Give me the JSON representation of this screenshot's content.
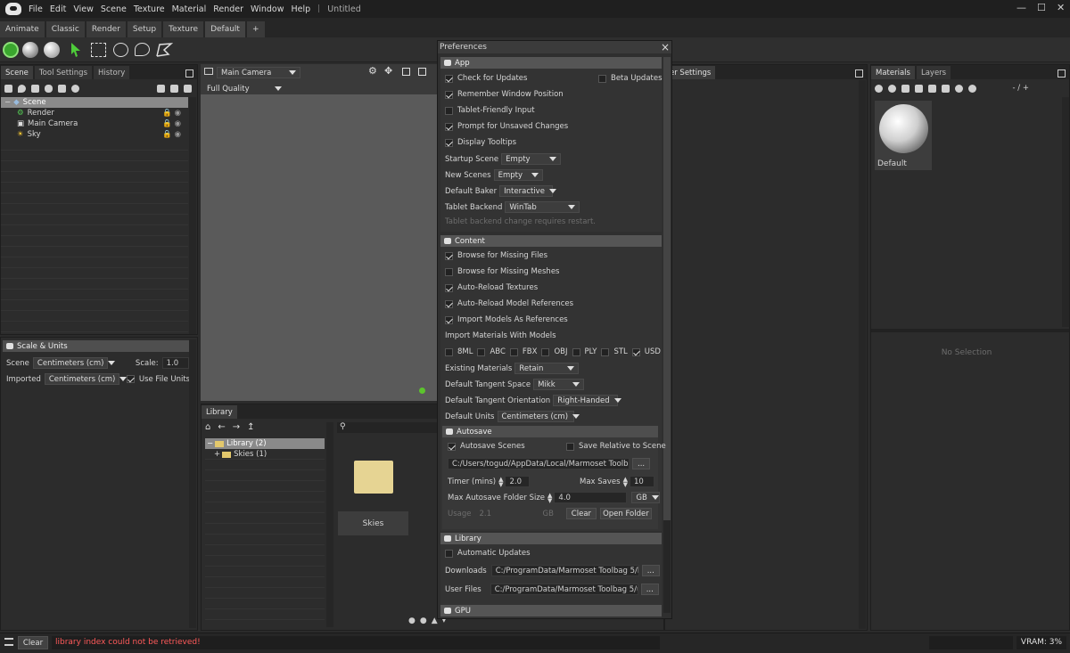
{
  "menubar": {
    "items": [
      "File",
      "Edit",
      "View",
      "Scene",
      "Texture",
      "Material",
      "Render",
      "Window",
      "Help"
    ],
    "title": "Untitled"
  },
  "workspace_tabs": [
    "Animate",
    "Classic",
    "Render",
    "Setup",
    "Texture",
    "Default",
    "+"
  ],
  "scene_panel": {
    "tabs": [
      "Scene",
      "Tool Settings",
      "History"
    ],
    "tree": [
      {
        "label": "Scene",
        "icon": "scene-icon"
      },
      {
        "label": "Render",
        "icon": "render-gear-icon"
      },
      {
        "label": "Main Camera",
        "icon": "camera-icon"
      },
      {
        "label": "Sky",
        "icon": "sky-icon"
      }
    ]
  },
  "scale_units": {
    "title": "Scale & Units",
    "scene_label": "Scene",
    "scene_value": "Centimeters (cm)",
    "scale_label": "Scale:",
    "scale_value": "1.0",
    "imported_label": "Imported",
    "imported_value": "Centimeters (cm)",
    "use_file_units": "Use File Units"
  },
  "viewport": {
    "camera": "Main Camera",
    "quality": "Full Quality",
    "status_color": "#5cc42d"
  },
  "library": {
    "tab": "Library",
    "tree": [
      "Library (2)",
      "Skies (1)"
    ],
    "folder_label": "Skies"
  },
  "render_settings_tab": "er Settings",
  "materials": {
    "tabs": [
      "Materials",
      "Layers"
    ],
    "counter": "- / +",
    "default_label": "Default",
    "no_selection": "No Selection"
  },
  "prefs": {
    "title": "Preferences",
    "close": "×",
    "app": {
      "title": "App",
      "check_updates": "Check for Updates",
      "beta_updates": "Beta Updates",
      "remember_window": "Remember Window Position",
      "tablet_friendly": "Tablet-Friendly Input",
      "prompt_unsaved": "Prompt for Unsaved Changes",
      "display_tooltips": "Display Tooltips",
      "startup_scene_label": "Startup Scene",
      "startup_scene": "Empty",
      "new_scenes_label": "New Scenes",
      "new_scenes": "Empty",
      "baker_label": "Default Baker",
      "baker": "Interactive",
      "tablet_backend_label": "Tablet Backend",
      "tablet_backend": "WinTab",
      "tablet_note": "Tablet backend change requires restart."
    },
    "content": {
      "title": "Content",
      "browse_files": "Browse for Missing Files",
      "browse_meshes": "Browse for Missing Meshes",
      "auto_textures": "Auto-Reload Textures",
      "auto_models": "Auto-Reload Model References",
      "import_refs": "Import Models As References",
      "import_materials": "Import Materials With Models",
      "formats": [
        "8ML",
        "ABC",
        "FBX",
        "OBJ",
        "PLY",
        "STL",
        "USD"
      ],
      "existing_label": "Existing Materials",
      "existing": "Retain",
      "tangent_space_label": "Default Tangent Space",
      "tangent_space": "Mikk",
      "tangent_orient_label": "Default Tangent Orientation",
      "tangent_orient": "Right-Handed",
      "units_label": "Default Units",
      "units": "Centimeters (cm)"
    },
    "autosave": {
      "title": "Autosave",
      "autosave_scenes": "Autosave Scenes",
      "save_relative": "Save Relative to Scene",
      "path": "C:/Users/togud/AppData/Local/Marmoset Toolbag 5/",
      "browse": "...",
      "timer_label": "Timer (mins)",
      "timer": "2.0",
      "max_saves_label": "Max Saves",
      "max_saves": "10",
      "max_folder_label": "Max Autosave Folder Size",
      "max_folder": "4.0",
      "unit": "GB",
      "usage_label": "Usage",
      "usage": "2.1",
      "usage_unit": "GB",
      "clear": "Clear",
      "open_folder": "Open Folder"
    },
    "library": {
      "title": "Library",
      "auto_updates": "Automatic Updates",
      "downloads_label": "Downloads",
      "downloads": "C:/ProgramData/Marmoset Toolbag 5/libra",
      "user_files_label": "User Files",
      "user_files": "C:/ProgramData/Marmoset Toolbag 5/user",
      "browse": "..."
    },
    "gpu": {
      "title": "GPU"
    }
  },
  "statusbar": {
    "clear": "Clear",
    "message": "library index could not be retrieved!",
    "vram": "VRAM: 3%",
    "error_color": "#ff5a5a"
  }
}
